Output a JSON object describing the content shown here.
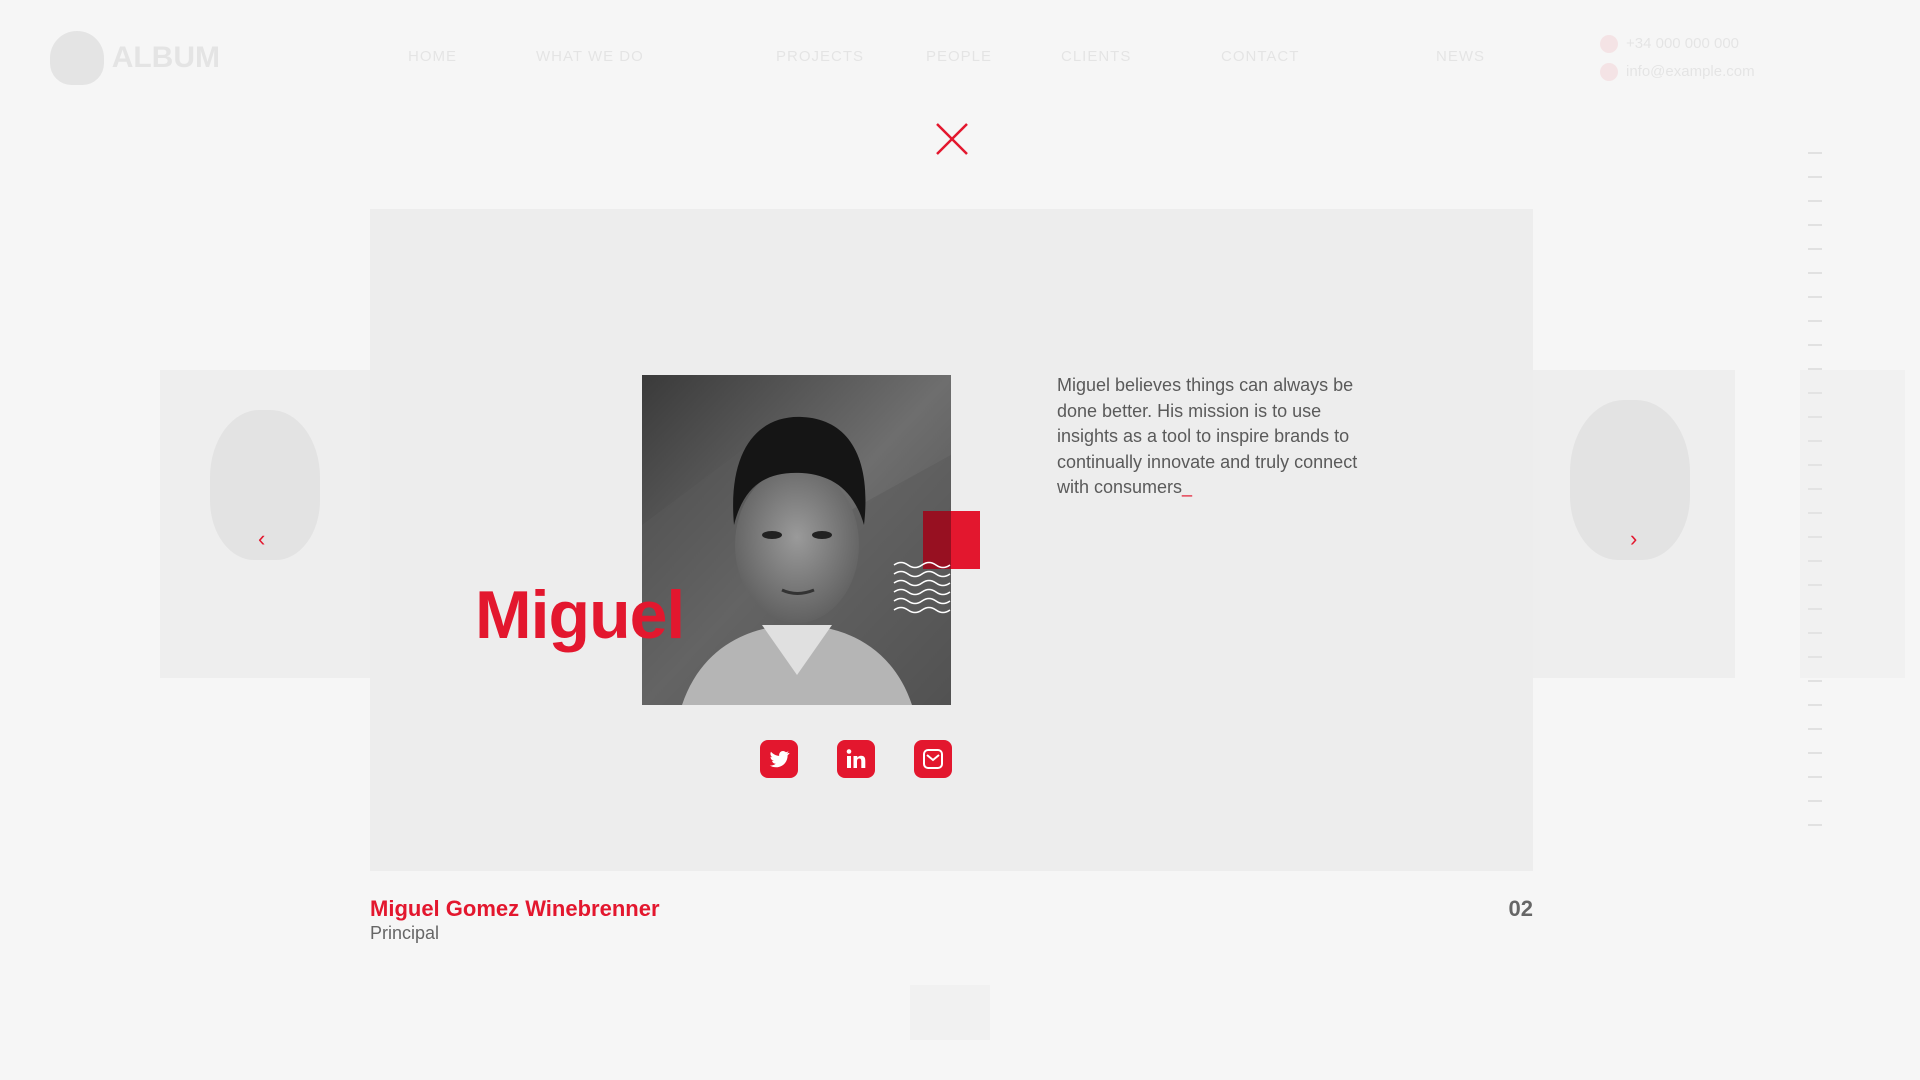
{
  "header": {
    "logo_text": "ALBUM",
    "nav": [
      "HOME",
      "WHAT WE DO",
      "PROJECTS",
      "PEOPLE",
      "CLIENTS",
      "CONTACT",
      "NEWS"
    ],
    "contact_phone": "+34 000 000 000",
    "contact_email": "info@example.com"
  },
  "modal": {
    "close_icon": "close-icon",
    "first_name": "Miguel",
    "bio": "Miguel believes things can always be done better. His mission is to use insights as a tool to inspire brands to continually innovate and truly connect with consumers",
    "bio_cursor": "_",
    "socials": [
      {
        "icon": "twitter-icon",
        "label": "Twitter"
      },
      {
        "icon": "linkedin-icon",
        "label": "LinkedIn"
      },
      {
        "icon": "email-icon",
        "label": "Email"
      }
    ],
    "full_name": "Miguel Gomez Winebrenner",
    "role": "Principal",
    "index": "02"
  },
  "colors": {
    "accent": "#e3172e",
    "panel": "#ededed",
    "background": "#f6f6f6",
    "text": "#5a5a5a"
  }
}
